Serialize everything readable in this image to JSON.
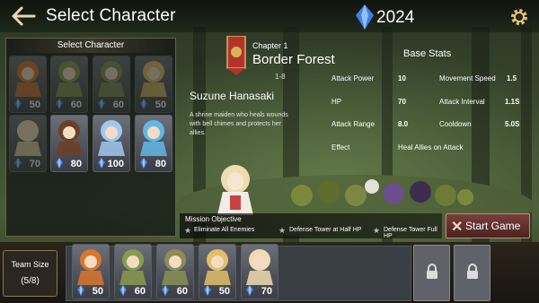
{
  "header": {
    "title": "Select Character",
    "currency": "2024"
  },
  "roster": {
    "heading": "Select Character",
    "cards": [
      {
        "cost": "50",
        "color": "#d9752f",
        "available": false
      },
      {
        "cost": "60",
        "color": "#8a9a50",
        "available": false
      },
      {
        "cost": "60",
        "color": "#8a8f55",
        "available": false
      },
      {
        "cost": "50",
        "color": "#e1c06a",
        "available": false
      },
      {
        "cost": "70",
        "color": "#efdcb2",
        "available": false
      },
      {
        "cost": "80",
        "color": "#6b4026",
        "available": true
      },
      {
        "cost": "100",
        "color": "#9fc8f0",
        "available": true
      },
      {
        "cost": "80",
        "color": "#61b8e6",
        "available": true
      }
    ]
  },
  "stage": {
    "chapter": "Chapter 1",
    "name": "Border Forest",
    "level": "1-8"
  },
  "character": {
    "name": "Suzune Hanasaki",
    "description": "A shrine maiden who heals wounds with bell chimes and protects her allies."
  },
  "stats": {
    "title": "Base Stats",
    "attack_power_label": "Attack Power",
    "attack_power": "10",
    "movement_speed_label": "Movement Speed",
    "movement_speed": "1.5",
    "hp_label": "HP",
    "hp": "70",
    "attack_interval_label": "Attack Interval",
    "attack_interval": "1.1S",
    "attack_range_label": "Attack Range",
    "attack_range": "8.0",
    "cooldown_label": "Cooldown",
    "cooldown": "5.0S",
    "effect_label": "Effect",
    "effect": "Heal Allies on Attack"
  },
  "mission": {
    "title": "Mission Objective",
    "objectives": [
      "Eliminate All Enemies",
      "Defense Tower at Half HP",
      "Defense Tower Full HP"
    ]
  },
  "actions": {
    "start": "Start Game"
  },
  "team": {
    "label": "Team Size",
    "count": "(5/8)",
    "members": [
      {
        "cost": "50",
        "color": "#d9752f"
      },
      {
        "cost": "60",
        "color": "#8a9a50"
      },
      {
        "cost": "60",
        "color": "#8a8f55"
      },
      {
        "cost": "50",
        "color": "#e1c06a"
      },
      {
        "cost": "70",
        "color": "#efdcb2"
      }
    ]
  },
  "colors": {
    "accent": "#3f7fe0",
    "start_button": "#6a3430",
    "panel_border": "#6b5d3e"
  },
  "icons": [
    "back-arrow-icon",
    "crystal-icon",
    "gear-icon",
    "gem-icon",
    "lock-icon",
    "star-icon",
    "close-x-icon",
    "chapter-banner-icon"
  ]
}
